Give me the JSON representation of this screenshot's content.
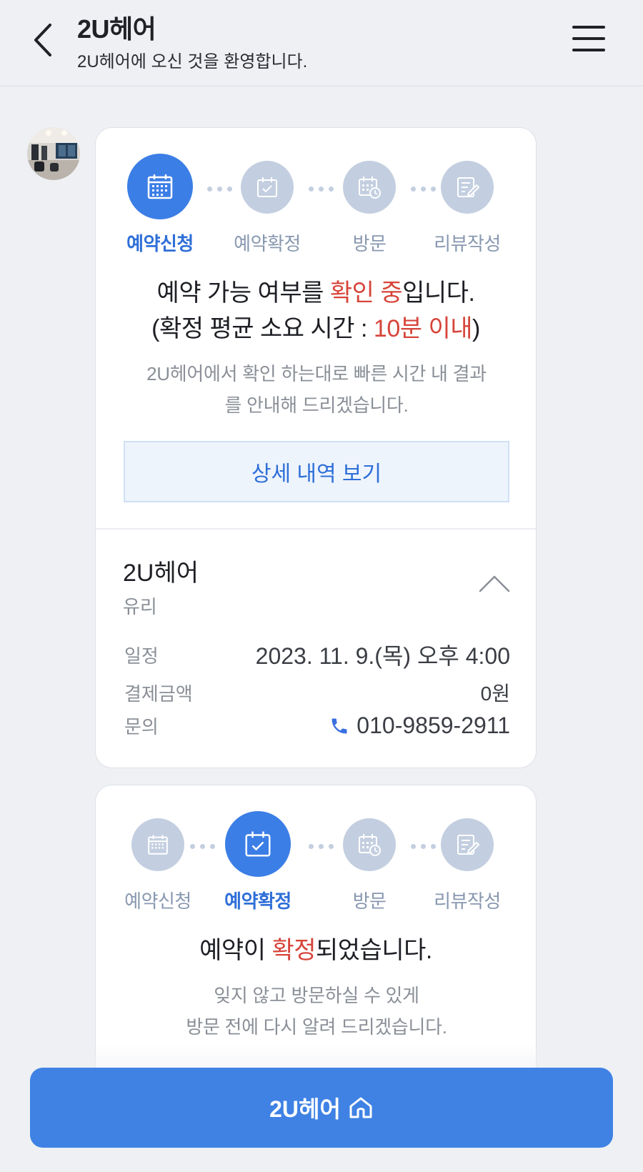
{
  "header": {
    "title": "2U헤어",
    "subtitle": "2U헤어에 오신 것을 환영합니다."
  },
  "steps": [
    "예약신청",
    "예약확정",
    "방문",
    "리뷰작성"
  ],
  "card1": {
    "active_step": 0,
    "status_line1_pre": "예약 가능 여부를 ",
    "status_line1_hl": "확인 중",
    "status_line1_post": "입니다.",
    "status_line2_pre": "(확정 평균 소요 시간 : ",
    "status_line2_hl": "10분 이내",
    "status_line2_post": ")",
    "desc_line1": "2U헤어에서 확인 하는대로 빠른 시간 내 결과",
    "desc_line2": "를 안내해 드리겠습니다.",
    "detail_button": "상세 내역 보기",
    "shop_name": "2U헤어",
    "designer": "유리",
    "rows": [
      {
        "label": "일정",
        "value": "2023. 11. 9.(목) 오후 4:00"
      },
      {
        "label": "결제금액",
        "value": "0원"
      },
      {
        "label": "문의",
        "value": "010-9859-2911"
      }
    ]
  },
  "card2": {
    "active_step": 1,
    "status_pre": "예약이 ",
    "status_hl": "확정",
    "status_post": "되었습니다.",
    "desc_line1": "잊지 않고 방문하실 수 있게",
    "desc_line2": "방문 전에 다시 알려 드리겠습니다."
  },
  "bottom_button": {
    "label": "2U헤어",
    "icon": "home-icon"
  },
  "colors": {
    "accent": "#3b7ee6",
    "highlight": "#d6453a",
    "inactive_step": "#c3cfe0"
  }
}
